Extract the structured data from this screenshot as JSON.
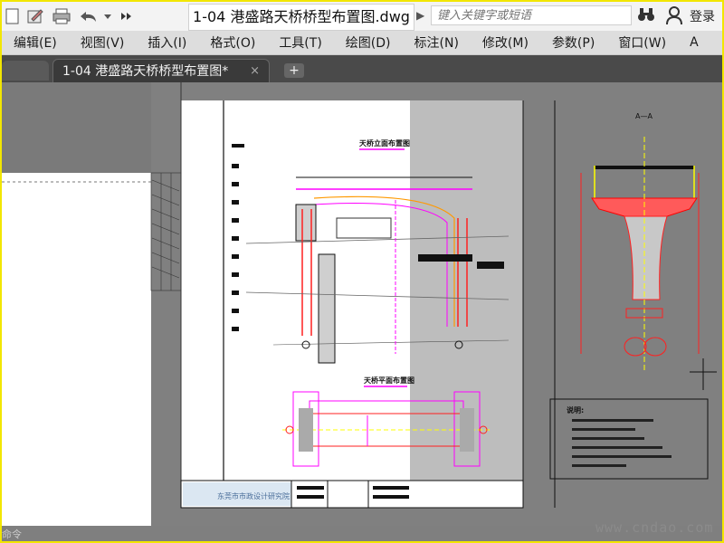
{
  "title_bar": {
    "document_title": "1-04 港盛路天桥桥型布置图.dwg",
    "search_placeholder": "键入关键字或短语",
    "login_label": "登录",
    "quick_access": [
      "new-icon",
      "open-icon",
      "save-icon",
      "print-icon",
      "undo-icon",
      "dropdown-icon",
      "more-icon"
    ]
  },
  "menu": {
    "items": [
      "编辑(E)",
      "视图(V)",
      "插入(I)",
      "格式(O)",
      "工具(T)",
      "绘图(D)",
      "标注(N)",
      "修改(M)",
      "参数(P)",
      "窗口(W)",
      "A"
    ]
  },
  "tabs": {
    "active_label": "1-04 港盛路天桥桥型布置图*",
    "close_glyph": "×",
    "add_glyph": "+"
  },
  "drawing": {
    "elevation_title": "天桥立面布置图",
    "plan_title": "天桥平面布置图",
    "section_title": "A—A",
    "notes_heading": "说明:",
    "company_name": "东莞市市政设计研究院",
    "colors": {
      "magenta": "#ff00ff",
      "red": "#ff2020",
      "yellow": "#ffff00",
      "dark_bg": "#808080",
      "paper": "#ffffff"
    }
  },
  "watermark": "www.cndao.com",
  "command_line": "命令"
}
